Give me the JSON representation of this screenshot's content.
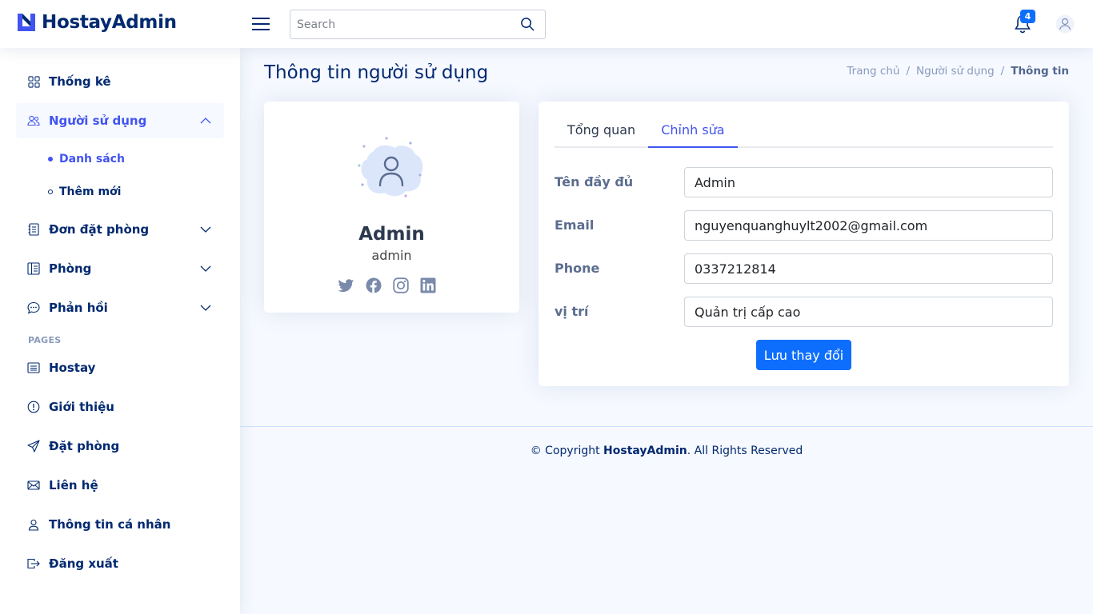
{
  "header": {
    "logo_text": "HostayAdmin",
    "search_placeholder": "Search",
    "notification_count": "4"
  },
  "sidebar": {
    "items": [
      {
        "label": "Thống kê",
        "icon": "grid-icon"
      },
      {
        "label": "Người sử dụng",
        "icon": "people-icon",
        "expanded": true
      },
      {
        "label": "Đơn đặt phòng",
        "icon": "journal-icon"
      },
      {
        "label": "Phòng",
        "icon": "layout-icon"
      },
      {
        "label": "Phản hồi",
        "icon": "chat-icon"
      }
    ],
    "sub_items": [
      {
        "label": "Danh sách",
        "active": true
      },
      {
        "label": "Thêm mới",
        "active": false
      }
    ],
    "pages_heading": "PAGES",
    "pages": [
      {
        "label": "Hostay",
        "icon": "card-list-icon"
      },
      {
        "label": "Giới thiệu",
        "icon": "info-circle-icon"
      },
      {
        "label": "Đặt phòng",
        "icon": "send-icon"
      },
      {
        "label": "Liên hệ",
        "icon": "envelope-icon"
      },
      {
        "label": "Thông tin cá nhân",
        "icon": "person-icon"
      },
      {
        "label": "Đăng xuất",
        "icon": "box-arrow-right-icon"
      }
    ]
  },
  "main": {
    "page_title": "Thông tin người sử dụng",
    "breadcrumb": [
      "Trang chủ",
      "Người sử dụng",
      "Thông tin"
    ],
    "profile": {
      "name": "Admin",
      "role": "admin"
    },
    "tabs": [
      "Tổng quan",
      "Chỉnh sửa"
    ],
    "active_tab": "Chỉnh sửa",
    "form": {
      "fullname_label": "Tên đầy đủ",
      "fullname_value": "Admin",
      "email_label": "Email",
      "email_value": "nguyenquanghuylt2002@gmail.com",
      "phone_label": "Phone",
      "phone_value": "0337212814",
      "position_label": "vị trí",
      "position_value": "Quản trị cấp cao",
      "save_label": "Lưu thay đổi"
    }
  },
  "footer": {
    "prefix": "© Copyright",
    "brand": "HostayAdmin",
    "suffix": ". All Rights Reserved"
  },
  "colors": {
    "primary": "#4154f1",
    "brand_dark": "#012970",
    "button": "#0d6efd"
  }
}
